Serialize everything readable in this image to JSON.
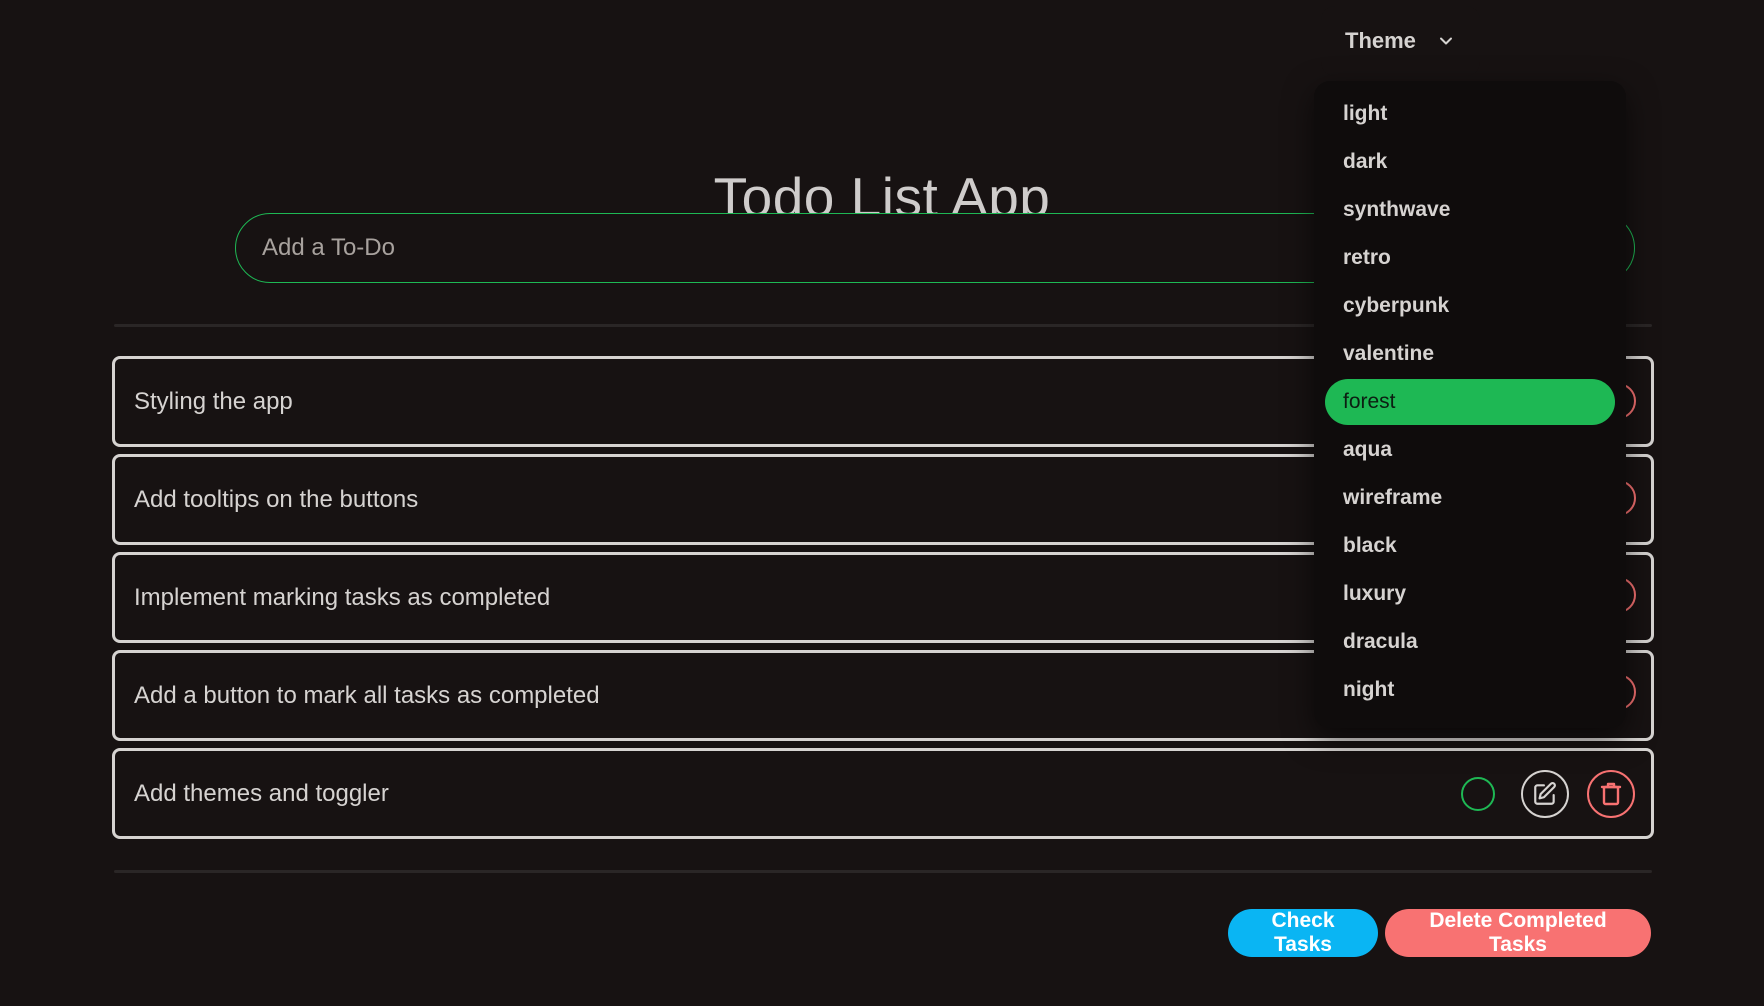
{
  "app": {
    "title": "Todo List App"
  },
  "add_todo": {
    "placeholder": "Add a To-Do",
    "value": ""
  },
  "tasks": [
    {
      "text": "Styling the app"
    },
    {
      "text": "Add tooltips on the buttons"
    },
    {
      "text": "Implement marking tasks as completed"
    },
    {
      "text": "Add a button to mark all tasks as completed"
    },
    {
      "text": "Add themes and toggler"
    }
  ],
  "footer": {
    "check_label": "Check Tasks",
    "delete_label": "Delete Completed Tasks"
  },
  "theme": {
    "trigger_label": "Theme",
    "selected": "forest",
    "options": [
      "light",
      "dark",
      "synthwave",
      "retro",
      "cyberpunk",
      "valentine",
      "forest",
      "aqua",
      "wireframe",
      "black",
      "luxury",
      "dracula",
      "night"
    ]
  },
  "icons": {
    "complete": "check-circle-icon",
    "edit": "edit-icon",
    "delete": "trash-icon",
    "dropdown": "chevron-down-icon"
  },
  "colors": {
    "background": "#171212",
    "primary": "#1eb854",
    "info": "#0ab5f3",
    "error": "#f87272",
    "text": "#d6d3d1"
  }
}
